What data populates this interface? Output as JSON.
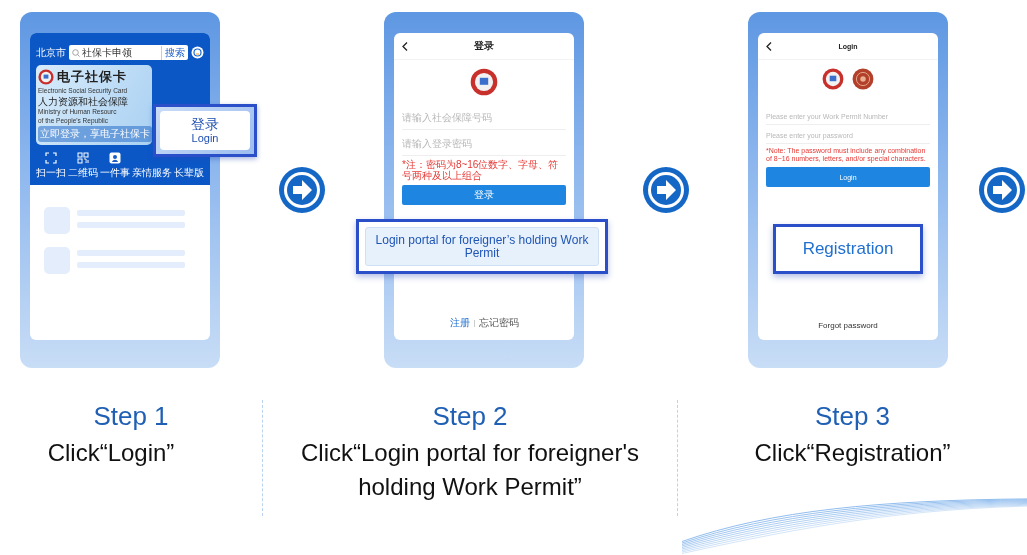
{
  "step_1_screen": {
    "city": "北京市",
    "search_value": "社保卡申领",
    "search_button": "搜索",
    "card": {
      "title": "电子社保卡",
      "subtitle": "Electronic Social Security Card",
      "ministry_cn": "人力资源和社会保障",
      "ministry_en_1": "Ministry of Human Resourc",
      "ministry_en_2": "of the People's Republic",
      "prompt": "立即登录，享电子社保卡"
    },
    "shortcuts": [
      {
        "kind": "scan",
        "label": "扫一扫"
      },
      {
        "kind": "qr",
        "label": "二维码"
      },
      {
        "kind": "card",
        "label": "一件事"
      },
      {
        "kind": "hidden",
        "label": "亲情服务"
      },
      {
        "kind": "hidden",
        "label": "长辈版"
      }
    ],
    "highlight": {
      "label_cn": "登录",
      "label_en": "Login"
    }
  },
  "step_2_screen": {
    "title": "登录",
    "fields": [
      {
        "placeholder": "请输入社会保障号码"
      },
      {
        "placeholder": "请输入登录密码"
      }
    ],
    "note": "*注：密码为8~16位数字、字母、符号两种及以上组合",
    "login_button": "登录",
    "highlight": "Login portal for foreigner’s holding Work Permit",
    "register_link": "注册",
    "forgot_link": "忘记密码"
  },
  "step_3_screen": {
    "title": "Login",
    "fields": [
      {
        "placeholder": "Please enter your Work Permit Number"
      },
      {
        "placeholder": "Please enter your password"
      }
    ],
    "note": "*Note: The password must include any combination of 8~16 numbers, letters, and/or special characters.",
    "login_button": "Login",
    "highlight": "Registration",
    "forgot_link": "Forgot password"
  },
  "steps": [
    {
      "title": "Step 1",
      "instruction": "Click“Login”"
    },
    {
      "title": "Step 2",
      "instruction": "Click“Login portal for foreigner's holding Work Permit”"
    },
    {
      "title": "Step 3",
      "instruction": "Click“Registration”"
    }
  ]
}
